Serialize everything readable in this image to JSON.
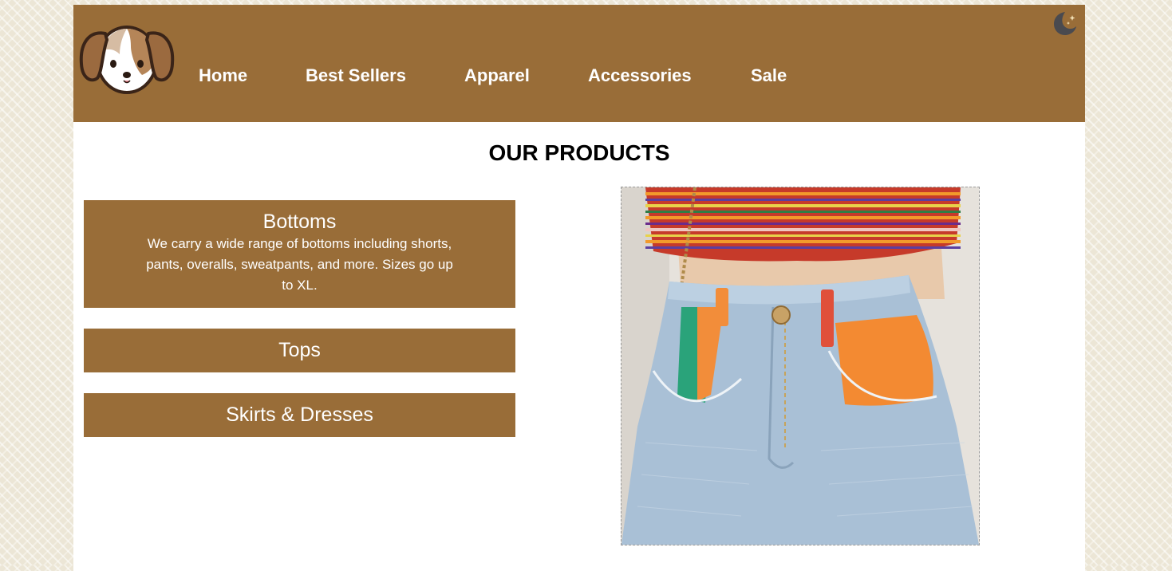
{
  "nav": {
    "items": [
      {
        "label": "Home"
      },
      {
        "label": "Best Sellers"
      },
      {
        "label": "Apparel"
      },
      {
        "label": "Accessories"
      },
      {
        "label": "Sale"
      }
    ]
  },
  "header": {
    "logo_icon": "puppy-face-icon",
    "theme_toggle_icon": "moon-stars-icon"
  },
  "main": {
    "title": "OUR PRODUCTS",
    "categories": [
      {
        "heading": "Bottoms",
        "description": "We carry a wide range of bottoms including shorts, pants, overalls, sweatpants, and more. Sizes go up to XL."
      },
      {
        "heading": "Tops"
      },
      {
        "heading": "Skirts & Dresses"
      }
    ],
    "product_image": "denim-shorts-photo"
  },
  "colors": {
    "brand": "#996d38",
    "page_background": "#ece6d6",
    "content_background": "#ffffff",
    "text_light": "#ffffff",
    "title_text": "#000000",
    "moon_icon": "#4a4a4f"
  }
}
